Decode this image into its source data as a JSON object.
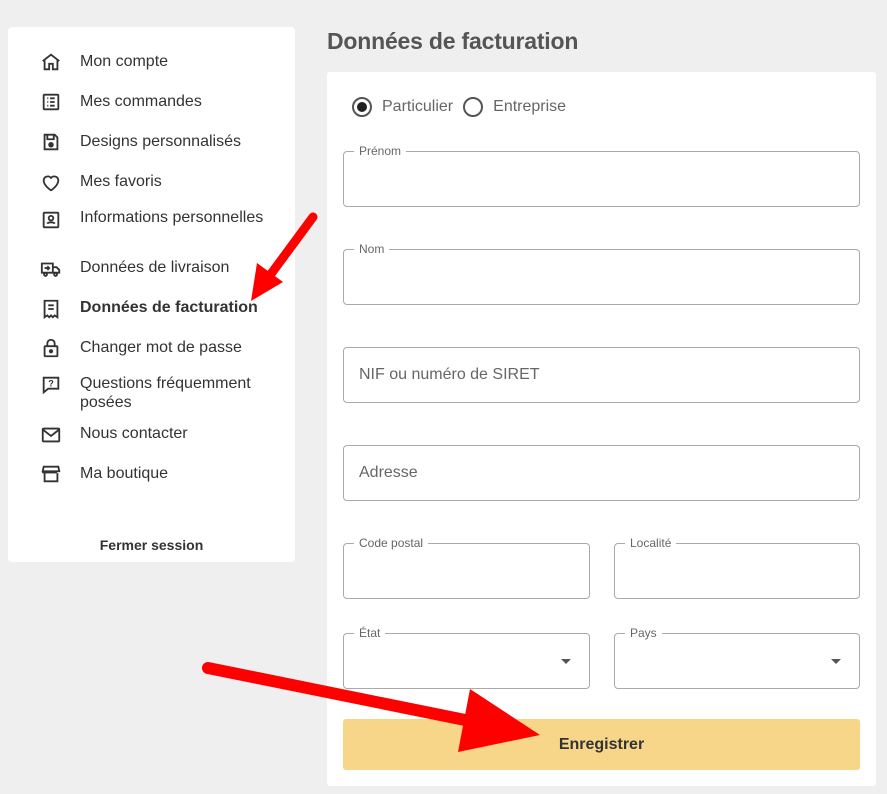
{
  "sidebar": {
    "items": [
      {
        "label": "Mon compte",
        "icon": "home-icon"
      },
      {
        "label": "Mes commandes",
        "icon": "list-icon"
      },
      {
        "label": "Designs personnalisés",
        "icon": "save-icon"
      },
      {
        "label": "Mes favoris",
        "icon": "heart-icon"
      },
      {
        "label": "Informations personnelles",
        "icon": "id-card-icon"
      },
      {
        "label": "Données de livraison",
        "icon": "truck-icon"
      },
      {
        "label": "Données de facturation",
        "icon": "receipt-icon",
        "active": true
      },
      {
        "label": "Changer mot de passe",
        "icon": "lock-icon"
      },
      {
        "label": "Questions fréquemment posées",
        "icon": "question-icon"
      },
      {
        "label": "Nous contacter",
        "icon": "mail-icon"
      },
      {
        "label": "Ma boutique",
        "icon": "store-icon"
      }
    ],
    "logout_label": "Fermer session"
  },
  "main": {
    "title": "Données de facturation",
    "radio": {
      "particulier": "Particulier",
      "entreprise": "Entreprise",
      "selected": "Particulier"
    },
    "fields": {
      "prenom": {
        "label": "Prénom",
        "value": ""
      },
      "nom": {
        "label": "Nom",
        "value": ""
      },
      "nif": {
        "placeholder": "NIF ou numéro de SIRET",
        "value": ""
      },
      "adresse": {
        "placeholder": "Adresse",
        "value": ""
      },
      "code_postal": {
        "label": "Code postal",
        "value": ""
      },
      "localite": {
        "label": "Localité",
        "value": ""
      },
      "etat": {
        "label": "État",
        "value": ""
      },
      "pays": {
        "label": "Pays",
        "value": ""
      }
    },
    "save_label": "Enregistrer"
  },
  "colors": {
    "accent": "#f7d68a",
    "annotation_arrow": "#ff0000"
  }
}
